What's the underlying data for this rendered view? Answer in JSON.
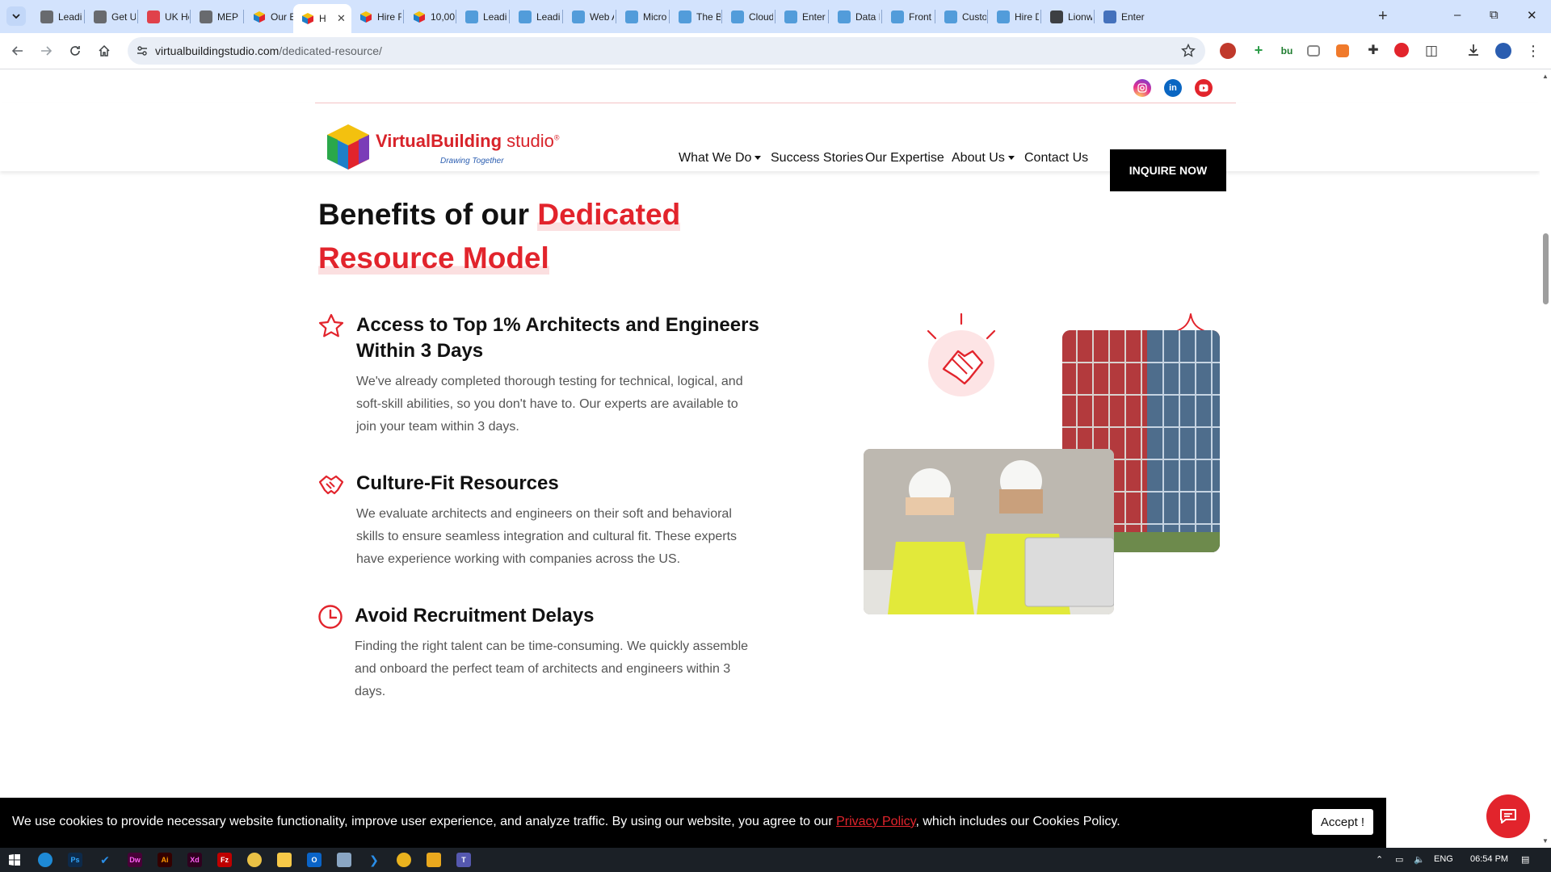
{
  "browser": {
    "tabs": [
      {
        "title": "Leadin",
        "fav": "#555"
      },
      {
        "title": "Get U",
        "fav": "#555"
      },
      {
        "title": "UK He",
        "fav": "#e2242c"
      },
      {
        "title": "MEP E",
        "fav": "#555"
      },
      {
        "title": "Our E",
        "fav": "cube"
      },
      {
        "title": "H",
        "fav": "cube",
        "active": true
      },
      {
        "title": "Hire R",
        "fav": "cube"
      },
      {
        "title": "10,00",
        "fav": "cube"
      },
      {
        "title": "Leadi",
        "fav": "#3b8fd4"
      },
      {
        "title": "Leadi",
        "fav": "#3b8fd4"
      },
      {
        "title": "Web A",
        "fav": "#3b8fd4"
      },
      {
        "title": "Micro",
        "fav": "#3b8fd4"
      },
      {
        "title": "The B",
        "fav": "#3b8fd4"
      },
      {
        "title": "Cloud",
        "fav": "#3b8fd4"
      },
      {
        "title": "Enter",
        "fav": "#3b8fd4"
      },
      {
        "title": "Data I",
        "fav": "#3b8fd4"
      },
      {
        "title": "Front",
        "fav": "#3b8fd4"
      },
      {
        "title": "Custo",
        "fav": "#3b8fd4"
      },
      {
        "title": "Hire D",
        "fav": "#3b8fd4"
      },
      {
        "title": "Lionw",
        "fav": "#222"
      },
      {
        "title": "Enter",
        "fav": "#2a5db0"
      }
    ],
    "url_host": "virtualbuildingstudio.com",
    "url_path": "/dedicated-resource/"
  },
  "site": {
    "logo": {
      "name": "VirtualBuilding",
      "suffix": "studio",
      "reg": "®",
      "tagline": "Drawing Together"
    },
    "nav": [
      {
        "label": "What We Do",
        "dropdown": true
      },
      {
        "label": "Success Stories",
        "dropdown": false
      },
      {
        "label": "Our Expertise",
        "dropdown": false
      },
      {
        "label": "About Us",
        "dropdown": true
      },
      {
        "label": "Contact Us",
        "dropdown": false
      }
    ],
    "cta": "INQUIRE NOW",
    "social": [
      "instagram-icon",
      "linkedin-icon",
      "youtube-icon"
    ]
  },
  "section": {
    "heading_plain": "Benefits of our ",
    "heading_highlight": "Dedicated Resource Model",
    "accent": "#e2242c",
    "benefits": [
      {
        "icon": "star-icon",
        "title": "Access to Top 1% Architects and Engineers Within 3 Days",
        "text": "We've already completed thorough testing for technical, logical, and soft-skill abilities, so you don't have to. Our experts are available to join your team within 3 days."
      },
      {
        "icon": "handshake-icon",
        "title": "Culture-Fit Resources",
        "text": "We evaluate architects and engineers on their soft and behavioral skills to ensure seamless integration and cultural fit. These experts have experience working with companies across the US."
      },
      {
        "icon": "clock-icon",
        "title": "Avoid Recruitment Delays",
        "text": "Finding the right talent can be time-consuming. We quickly assemble and onboard the perfect team of architects and engineers within 3 days."
      }
    ]
  },
  "cookie": {
    "text_before": "We use cookies to provide necessary website functionality, improve user experience, and analyze traffic. By using our website, you agree to our ",
    "link": "Privacy Policy",
    "text_after": ", which includes our Cookies Policy.",
    "accept": "Accept !"
  },
  "taskbar": {
    "language": "ENG",
    "time": "06:54 PM"
  }
}
